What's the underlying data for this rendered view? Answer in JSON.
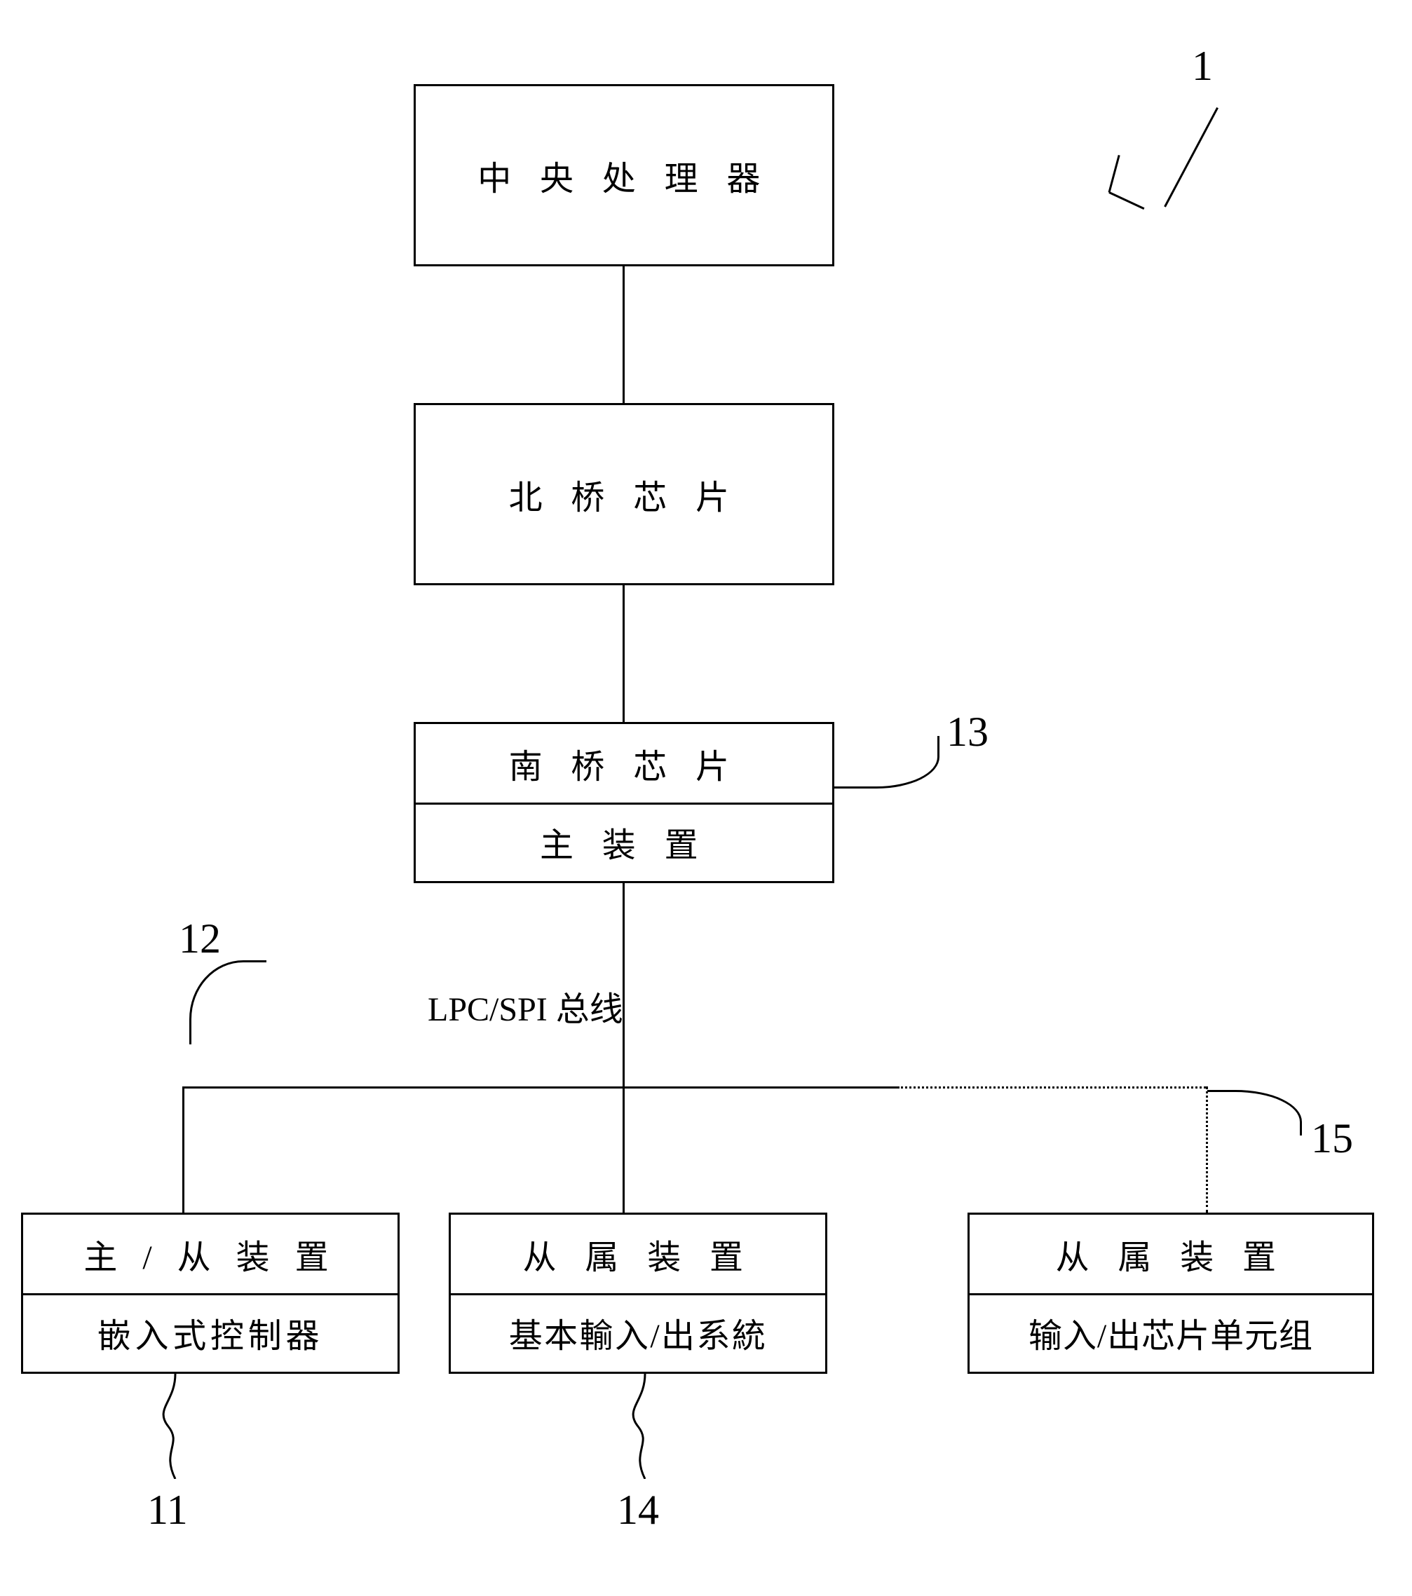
{
  "system_label": "1",
  "blocks": {
    "cpu": {
      "label": "中 央 处 理 器"
    },
    "northbridge": {
      "label": "北 桥 芯 片"
    },
    "southbridge": {
      "top_label": "南 桥 芯 片",
      "bottom_label": "主 装 置",
      "callout": "13"
    },
    "bus": {
      "label": "LPC/SPI 总线",
      "callout": "12"
    },
    "embedded_controller": {
      "top_label": "主 / 从 装 置",
      "bottom_label": "嵌入式控制器",
      "callout": "11"
    },
    "bios": {
      "top_label": "从 属 装 置",
      "bottom_label": "基本輸入/出系統",
      "callout": "14"
    },
    "io_chip": {
      "top_label": "从 属 装 置",
      "bottom_label": "输入/出芯片单元组",
      "callout": "15"
    }
  }
}
